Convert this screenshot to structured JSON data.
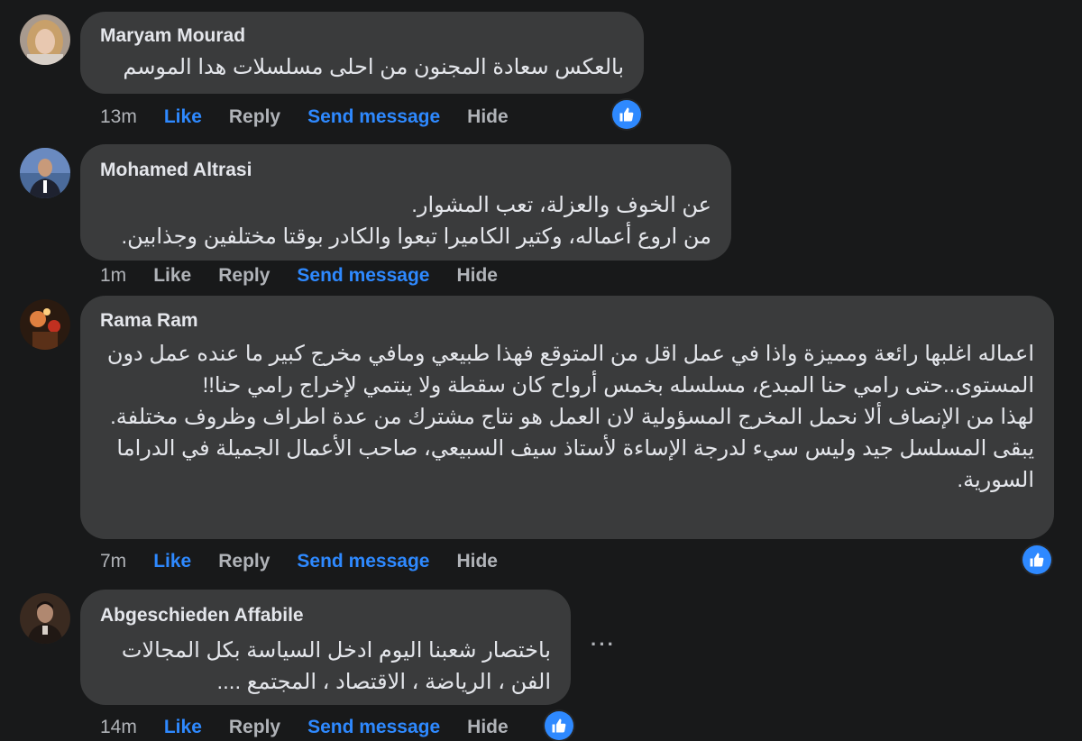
{
  "actions": {
    "like_label": "Like",
    "reply_label": "Reply",
    "send_label": "Send message",
    "hide_label": "Hide"
  },
  "more_dots": "···",
  "colors": {
    "background": "#18191a",
    "bubble": "#3a3b3c",
    "text": "#e4e6eb",
    "secondary": "#b0b3b8",
    "accent": "#2e89ff"
  },
  "comments": [
    {
      "author": "Maryam Mourad",
      "text": "بالعكس سعادة المجنون من احلى مسلسلات هدا الموسم",
      "time": "13m",
      "liked": true,
      "reaction": "like-icon"
    },
    {
      "author": "Mohamed Altrasi",
      "text": "عن الخوف والعزلة، تعب المشوار.\nمن اروع أعماله، وكتير الكاميرا تبعوا والكادر بوقتا مختلفين وجذابين.",
      "time": "1m",
      "liked": false,
      "reaction": ""
    },
    {
      "author": "Rama Ram",
      "text": "اعماله اغلبها رائعة ومميزة واذا في عمل اقل من المتوقع فهذا طبيعي ومافي مخرج كبير ما عنده عمل دون المستوى..حتى رامي حنا المبدع، مسلسله بخمس أرواح كان سقطة ولا ينتمي لإخراج رامي حنا!!\nلهذا من الإنصاف ألا نحمل المخرج المسؤولية لان العمل هو نتاج مشترك من عدة اطراف وظروف مختلفة.\nيبقى المسلسل جيد وليس سيء لدرجة الإساءة لأستاذ سيف السبيعي، صاحب الأعمال الجميلة في الدراما السورية.",
      "time": "7m",
      "liked": true,
      "reaction": "like-icon"
    },
    {
      "author": "Abgeschieden Affabile",
      "text": "باختصار شعبنا اليوم ادخل السياسة بكل المجالات\nالفن ، الرياضة ، الاقتصاد ، المجتمع ....",
      "time": "14m",
      "liked": true,
      "reaction": "like-icon"
    }
  ]
}
